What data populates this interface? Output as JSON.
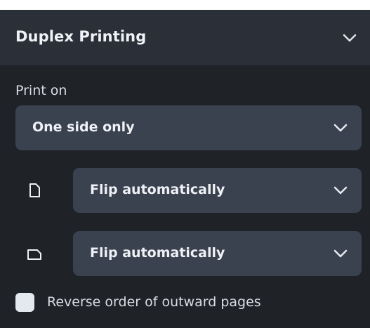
{
  "section": {
    "title": "Duplex Printing",
    "expanded": true,
    "chevron_icon": "chevron-down-icon"
  },
  "print_on": {
    "label": "Print on",
    "selected": "One side only"
  },
  "portrait_flip": {
    "icon": "portrait-page-icon",
    "selected": "Flip automatically"
  },
  "landscape_flip": {
    "icon": "landscape-page-icon",
    "selected": "Flip automatically"
  },
  "reverse_order": {
    "label": "Reverse order of outward pages",
    "checked": false
  },
  "colors": {
    "panel_bg": "#1f2227",
    "header_bg": "#2b3038",
    "select_bg": "#3a4250",
    "text": "#eef1f5"
  }
}
